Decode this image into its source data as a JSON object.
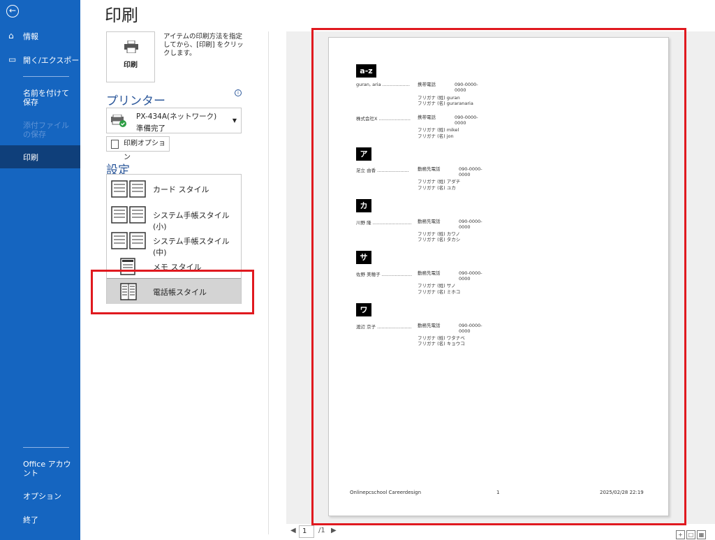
{
  "nav": {
    "back_icon": "back-arrow-icon",
    "info": "情報",
    "open_export": "開く/エクスポート",
    "save_as": "名前を付けて保存",
    "save_attachment": "添付ファイルの保存",
    "print": "印刷",
    "office_account": "Office アカウント",
    "options": "オプション",
    "exit": "終了"
  },
  "page_title": "印刷",
  "print_button": {
    "label": "印刷",
    "description": "アイテムの印刷方法を指定してから、[印刷] をクリックします。"
  },
  "printer": {
    "section": "プリンター",
    "name": "PX-434A(ネットワーク)",
    "status": "準備完了",
    "options_button": "印刷オプション"
  },
  "settings": {
    "section": "設定",
    "styles": [
      {
        "label": "カード スタイル",
        "selected": false
      },
      {
        "label": "システム手帳スタイル (小)",
        "selected": false
      },
      {
        "label": "システム手帳スタイル (中)",
        "selected": false
      },
      {
        "label": "メモ スタイル",
        "selected": false
      },
      {
        "label": "電話帳スタイル",
        "selected": true
      }
    ]
  },
  "preview": {
    "groups": [
      {
        "header": "a-z",
        "entries": [
          {
            "name": "guran, aria ...................",
            "label": "携帯電話",
            "tel": "090-0000-0000",
            "furigana_last": "フリガナ (姓) guran",
            "furigana_first": "フリガナ (名) guraranaria"
          },
          {
            "name": "株式会社X ......................",
            "label": "携帯電話",
            "tel": "090-0000-0000",
            "furigana_last": "フリガナ (姓) mikel",
            "furigana_first": "フリガナ (名) jon"
          }
        ]
      },
      {
        "header": "ア",
        "entries": [
          {
            "name": "足立 由香 ......................",
            "label": "勤務先電話",
            "tel": "090-0000-0000",
            "furigana_last": "フリガナ (姓) アダチ",
            "furigana_first": "フリガナ (名) ユカ"
          }
        ]
      },
      {
        "header": "カ",
        "entries": [
          {
            "name": "川野 隆 ...........................",
            "label": "勤務先電話",
            "tel": "090-0000-0000",
            "furigana_last": "フリガナ (姓) カワノ",
            "furigana_first": "フリガナ (名) タカシ"
          }
        ]
      },
      {
        "header": "サ",
        "entries": [
          {
            "name": "佐野 美穂子 .....................",
            "label": "勤務先電話",
            "tel": "090-0000-0000",
            "furigana_last": "フリガナ (姓) サノ",
            "furigana_first": "フリガナ (名) ミホコ"
          }
        ]
      },
      {
        "header": "ワ",
        "entries": [
          {
            "name": "渡辺 京子 ........................",
            "label": "勤務先電話",
            "tel": "090-0000-0000",
            "furigana_last": "フリガナ (姓) ワタナベ",
            "furigana_first": "フリガナ (名) キョウコ"
          }
        ]
      }
    ],
    "footer_left": "Onlinepcschool Careerdesign",
    "footer_center": "1",
    "footer_right": "2025/02/28 22:19"
  },
  "pager": {
    "current": "1",
    "total": "/1"
  },
  "colors": {
    "nav_bg": "#1565c0",
    "nav_selected": "#0f3f7a",
    "accent": "#2b579a",
    "highlight": "#e0191f"
  }
}
